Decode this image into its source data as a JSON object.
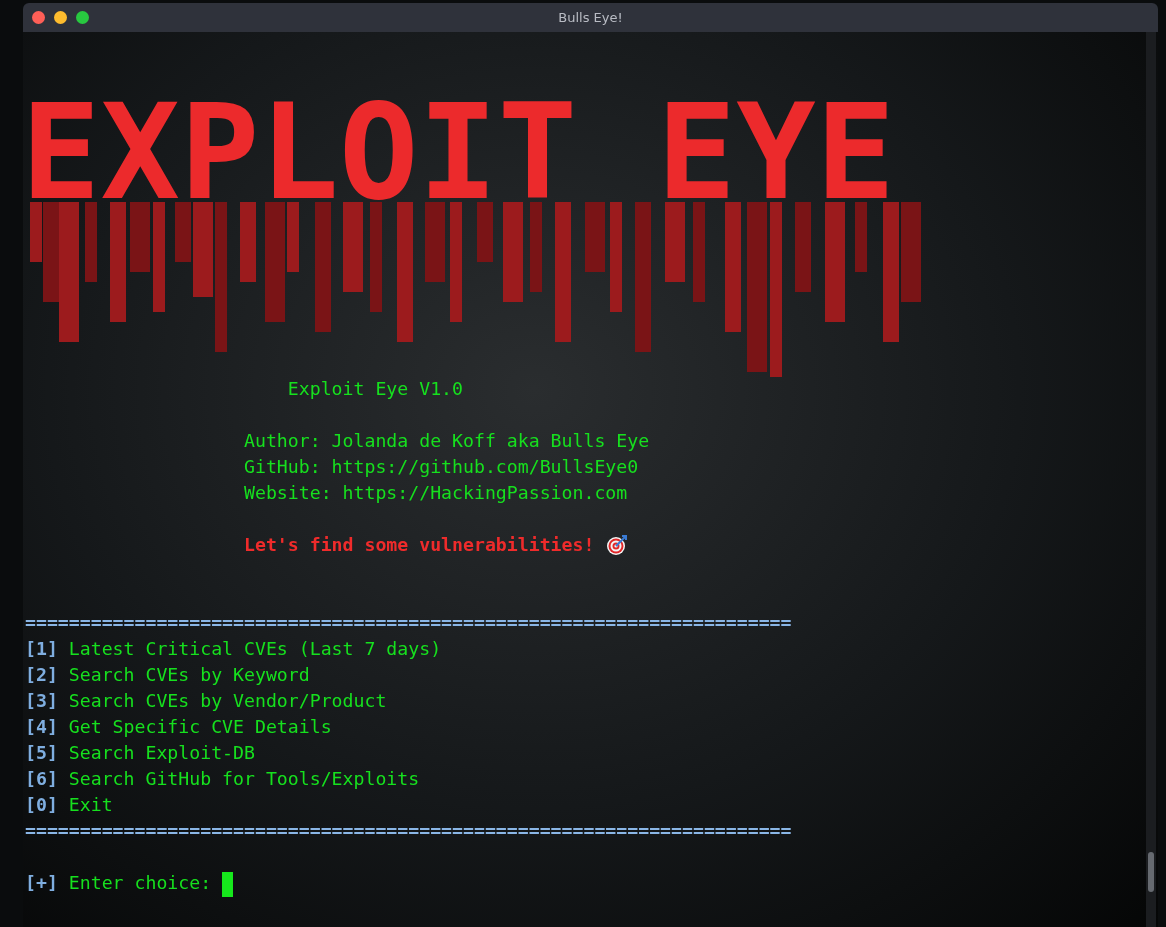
{
  "window": {
    "title": "Bulls Eye!"
  },
  "banner": {
    "text": "EXPLOIT EYE"
  },
  "info": {
    "version": "Exploit Eye V1.0",
    "lines": [
      "Author: Jolanda de Koff aka Bulls Eye",
      "GitHub: https://github.com/BullsEye0",
      "Website: https://HackingPassion.com"
    ],
    "tagline": "Let's find some vulnerabilities!"
  },
  "separator": "======================================================================",
  "menu": [
    {
      "key": "[1]",
      "label": "Latest Critical CVEs (Last 7 days)"
    },
    {
      "key": "[2]",
      "label": "Search CVEs by Keyword"
    },
    {
      "key": "[3]",
      "label": "Search CVEs by Vendor/Product"
    },
    {
      "key": "[4]",
      "label": "Get Specific CVE Details"
    },
    {
      "key": "[5]",
      "label": "Search Exploit-DB"
    },
    {
      "key": "[6]",
      "label": "Search GitHub for Tools/Exploits"
    },
    {
      "key": "[0]",
      "label": "Exit"
    }
  ],
  "separator_bottom": "======================================================================",
  "prompt": {
    "marker": "[+]",
    "text": "Enter choice:"
  }
}
